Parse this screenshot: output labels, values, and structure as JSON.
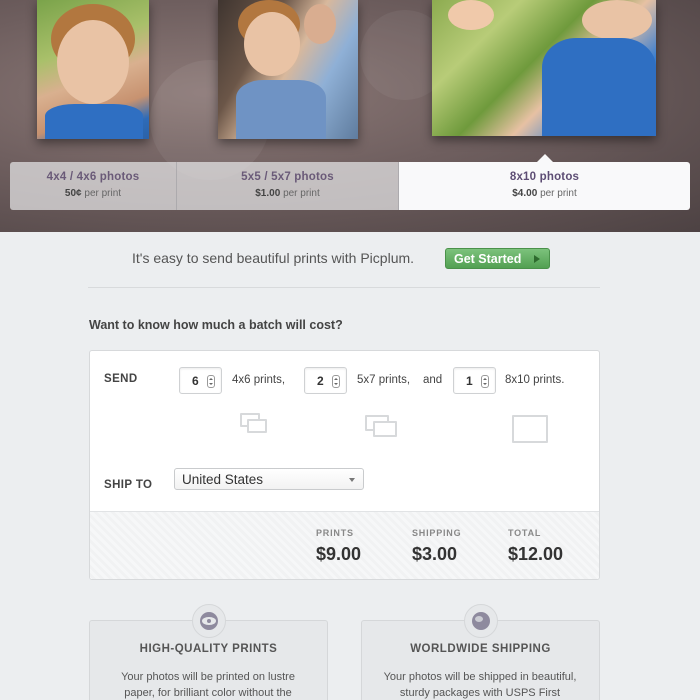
{
  "hero": {
    "tabs": [
      {
        "title": "4x4 / 4x6 photos",
        "price": "50¢",
        "unit": "per print"
      },
      {
        "title": "5x5 / 5x7 photos",
        "price": "$1.00",
        "unit": "per print"
      },
      {
        "title": "8x10 photos",
        "price": "$4.00",
        "unit": "per print"
      }
    ],
    "selected_tab": "8x10 photos"
  },
  "intro": {
    "text": "It's easy to send beautiful prints with Picplum.",
    "button_label": "Get Started"
  },
  "calculator": {
    "title": "Want to know how much a batch will cost?",
    "send_label": "SEND",
    "qty_4x6": "6",
    "label_4x6": "4x6 prints,",
    "qty_5x7": "2",
    "label_5x7": "5x7 prints,",
    "and_label": "and",
    "qty_8x10": "1",
    "label_8x10": "8x10 prints.",
    "ship_to_label": "SHIP TO",
    "country": "United States",
    "totals": {
      "prints_label": "PRINTS",
      "prints_value": "$9.00",
      "shipping_label": "SHIPPING",
      "shipping_value": "$3.00",
      "total_label": "TOTAL",
      "total_value": "$12.00"
    }
  },
  "features": [
    {
      "icon": "eye-icon",
      "title": "HIGH-QUALITY PRINTS",
      "text": "Your photos will be printed on lustre paper, for brilliant color without the"
    },
    {
      "icon": "globe-icon",
      "title": "WORLDWIDE SHIPPING",
      "text": "Your photos will be shipped in beautiful, sturdy packages with USPS First"
    }
  ],
  "colors": {
    "accent_green": "#5aa65a",
    "tab_text": "#5d4d74",
    "background": "#eceef0"
  }
}
